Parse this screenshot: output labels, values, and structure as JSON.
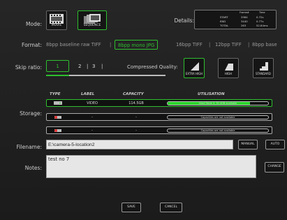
{
  "mode": {
    "label": "Mode:",
    "options": [
      {
        "label": "MOVIE"
      },
      {
        "label": "SEQUENCE"
      }
    ]
  },
  "details": {
    "label": "Details:",
    "headers": [
      "Frame#",
      "Time"
    ],
    "rows": [
      {
        "name": "START",
        "frame": "2984",
        "time": "0.72s"
      },
      {
        "name": "END",
        "frame": "3440",
        "time": "0.77s"
      },
      {
        "name": "TOTAL",
        "frame": "263",
        "time": "52.84ms"
      }
    ]
  },
  "format": {
    "label": "Format:",
    "options": [
      "8bpp baseline raw TIFF",
      "8bpp mono JPG",
      "16bpp TIFF",
      "12bpp TIFF",
      "8bpp base"
    ],
    "selected": "8bpp mono JPG"
  },
  "skip": {
    "label": "Skip ratio:",
    "values": [
      "1",
      "2",
      "3"
    ],
    "selected": "1"
  },
  "quality": {
    "label": "Compressed Quality:",
    "options": [
      "EXTRA HIGH",
      "HIGH",
      "STANDARD"
    ],
    "selected": "EXTRA HIGH"
  },
  "storage": {
    "label": "Storage:",
    "headers": {
      "type": "TYPE",
      "label": "LABEL",
      "capacity": "CAPACITY",
      "util": "UTILISATION"
    },
    "rows": [
      {
        "label": "VIDEO",
        "capacity": "114.5GB",
        "util_text": "Used Table 4, 32.4GB available",
        "fill": 0.82,
        "selected": true
      },
      {
        "label": "-",
        "capacity": "-",
        "util_text": "Capacities are not available",
        "fill": 0.0,
        "selected": false
      },
      {
        "label": "-",
        "capacity": "-",
        "util_text": "Capacities are not available",
        "fill": 0.0,
        "selected": false
      }
    ]
  },
  "filename": {
    "label": "Filename:",
    "value": "E:\\camera-5-location2",
    "manual": "MANUAL",
    "auto": "AUTO"
  },
  "notes": {
    "label": "Notes:",
    "value": "test no 7",
    "change": "CHANGE"
  },
  "actions": {
    "save": "SAVE",
    "cancel": "CANCEL"
  },
  "colors": {
    "accent": "#2fbf2f",
    "fill": "#2bd62b"
  }
}
